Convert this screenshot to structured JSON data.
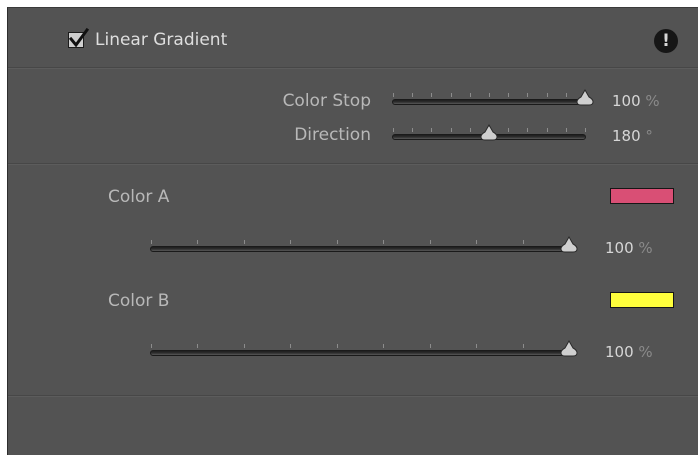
{
  "panel": {
    "enabled": true,
    "title": "Linear Gradient",
    "alert_icon": "exclamation-circle-icon",
    "alert_glyph": "!"
  },
  "gradient": {
    "color_stop": {
      "label": "Color Stop",
      "value": "100",
      "unit": "%",
      "level": 1.0
    },
    "direction": {
      "label": "Direction",
      "value": "180",
      "unit": "°",
      "level": 0.5
    }
  },
  "colors": {
    "color_a": {
      "label": "Color A",
      "swatch": "#d94f75",
      "opacity_value": "100",
      "opacity_unit": "%",
      "level": 1.0
    },
    "color_b": {
      "label": "Color B",
      "swatch": "#ffff3c",
      "opacity_value": "100",
      "opacity_unit": "%",
      "level": 1.0
    }
  }
}
